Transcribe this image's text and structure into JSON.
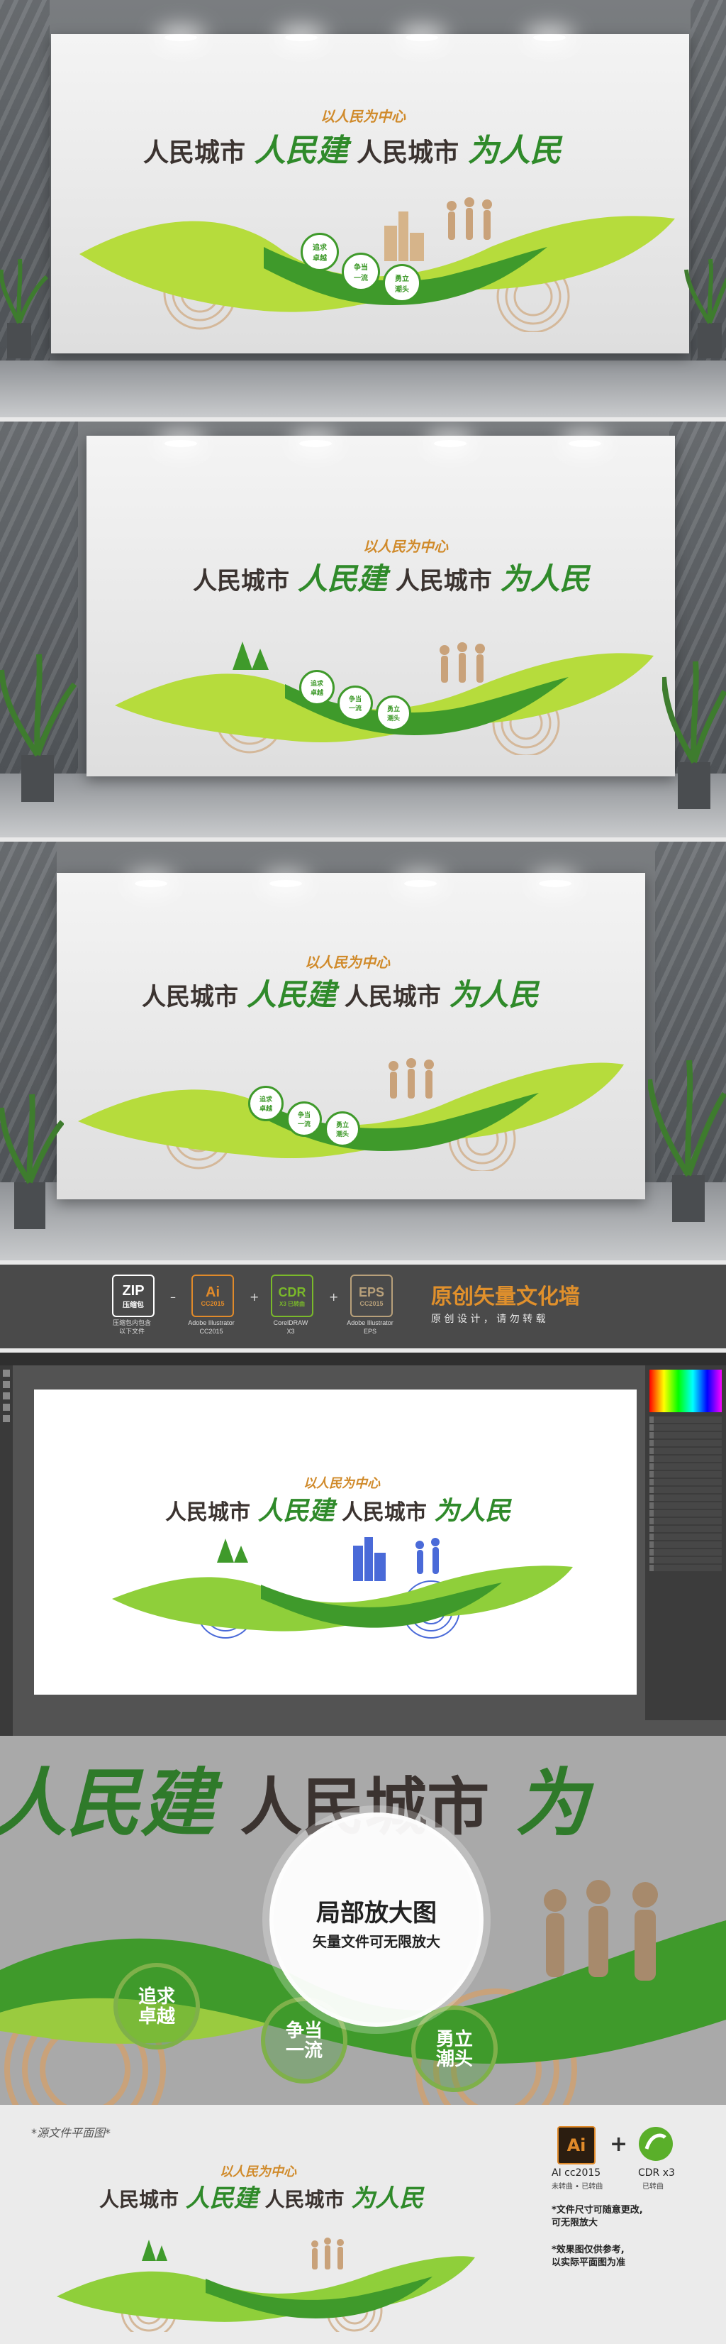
{
  "mockup": {
    "slogan_top": "以人民为中心",
    "slogan_part1": "人民城市",
    "slogan_part2": "人民建",
    "slogan_part3": "人民城市",
    "slogan_part4": "为人民",
    "badges": [
      "追求卓越",
      "争当一流",
      "勇立潮头"
    ]
  },
  "formats": {
    "zip_label": "ZIP",
    "zip_sub": "压缩包",
    "zip_caption": "压缩包内包含\n以下文件",
    "ai_label": "Ai",
    "ai_version": "CC2015",
    "ai_caption": "Adobe Illustrator\nCC2015",
    "cdr_label": "CDR",
    "cdr_version": "X3 已转曲",
    "cdr_caption": "CorelDRAW\nX3",
    "eps_label": "EPS",
    "eps_version": "CC2015",
    "eps_caption": "Adobe Illustrator\nEPS",
    "title": "原创矢量文化墙",
    "subtitle": "原 创 设 计 ， 请 勿 转 载"
  },
  "zoom": {
    "text_left": "人民建",
    "text_mid": "人民城市",
    "text_right": "为",
    "circle_title": "局部放大图",
    "circle_sub": "矢量文件可无限放大",
    "badges": [
      "追求卓越",
      "争当一流",
      "勇立潮头"
    ]
  },
  "source": {
    "heading": "*源文件平面图*",
    "ai_icon": "Ai",
    "ai_label": "AI cc2015",
    "ai_note": "未转曲 • 已转曲",
    "plus": "+",
    "cdr_label": "CDR x3",
    "cdr_note": "已转曲",
    "note1": "*文件尺寸可随意更改,\n  可无限放大",
    "note2": "*效果图仅供参考,\n  以实际平面图为准"
  },
  "colors": {
    "green_light": "#b6dc3c",
    "green_dark": "#3f9a2b",
    "tan": "#c9a27a",
    "brown_text": "#3b3330",
    "orange": "#d08a2a"
  }
}
